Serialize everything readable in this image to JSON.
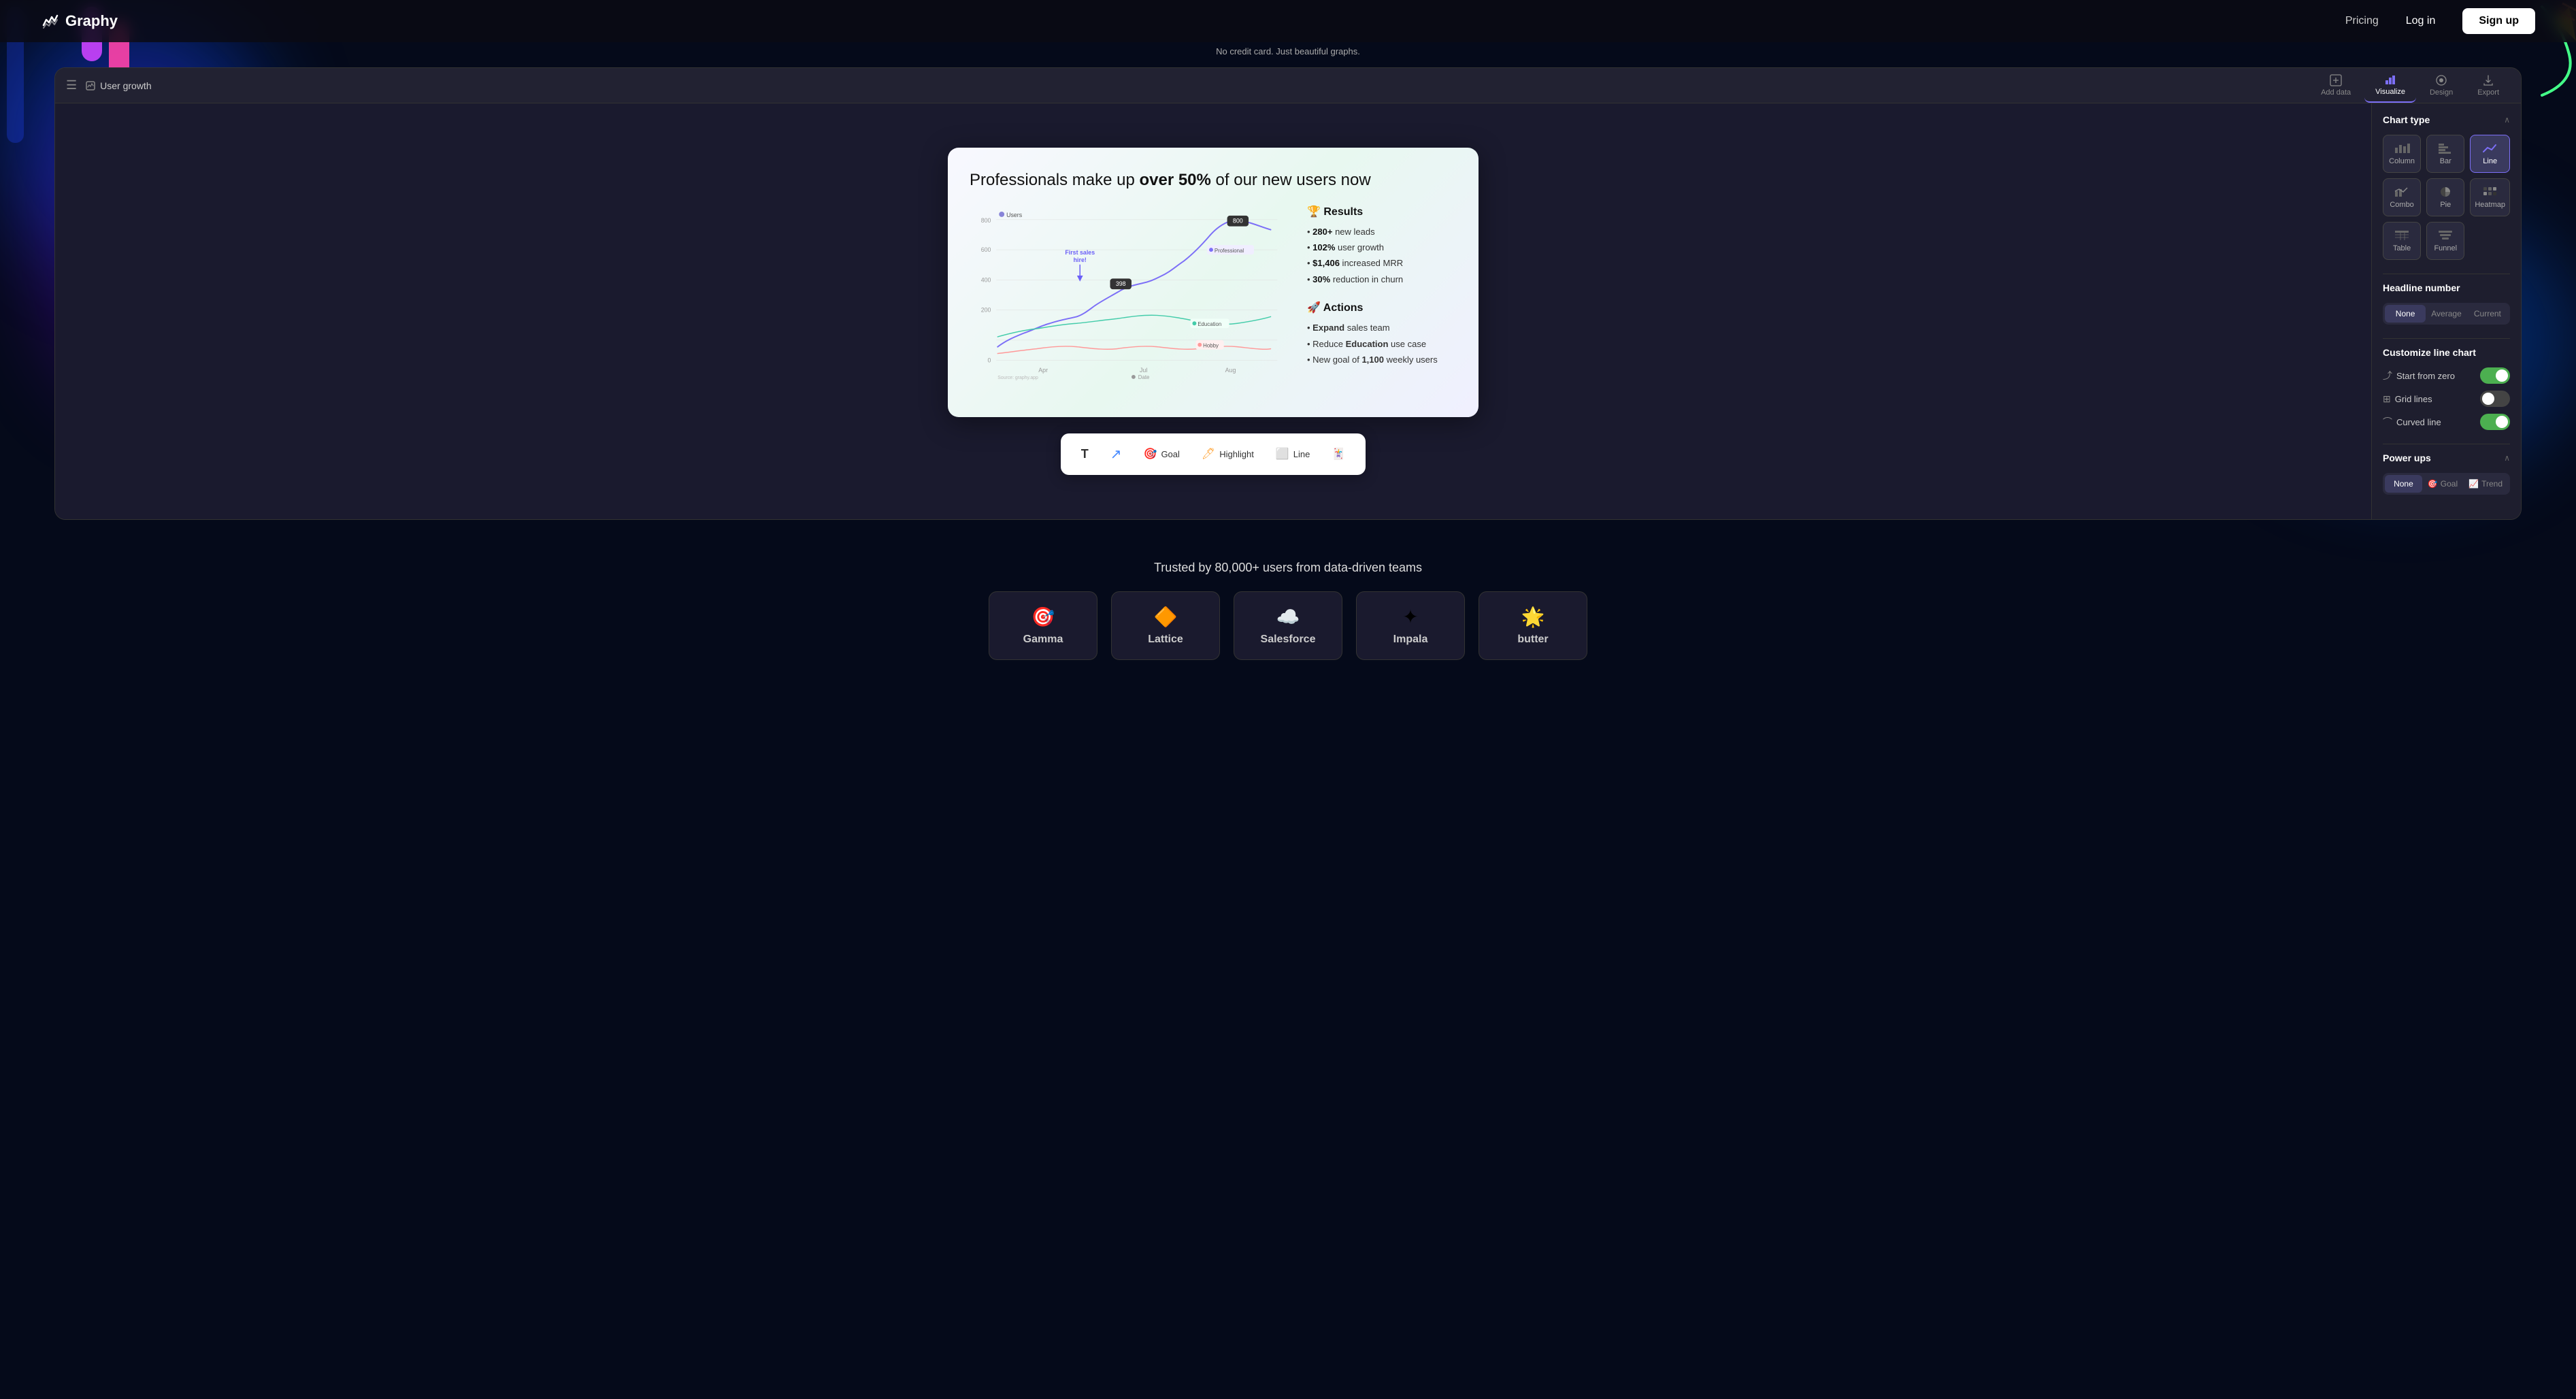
{
  "navbar": {
    "logo": "Graphy",
    "pricing": "Pricing",
    "login": "Log in",
    "signup": "Sign up"
  },
  "tagline": "No credit card. Just beautiful graphs.",
  "app": {
    "title": "User growth",
    "toolbar_buttons": [
      {
        "id": "add-data",
        "label": "Add data"
      },
      {
        "id": "visualize",
        "label": "Visualize",
        "active": true
      },
      {
        "id": "design",
        "label": "Design"
      },
      {
        "id": "export",
        "label": "Export"
      }
    ]
  },
  "chart_card": {
    "title_prefix": "Professionals make up ",
    "title_highlight": "over 50%",
    "title_suffix": " of our new users now",
    "legend": {
      "users_label": "Users"
    },
    "annotations": [
      {
        "label": "800",
        "type": "badge"
      },
      {
        "label": "Professional",
        "type": "legend-tag"
      },
      {
        "label": "398",
        "type": "badge"
      },
      {
        "label": "First sales hire!",
        "type": "annotation-text"
      },
      {
        "label": "Education",
        "type": "legend-tag"
      },
      {
        "label": "Hobby",
        "type": "legend-tag"
      }
    ],
    "y_labels": [
      "800",
      "600",
      "400",
      "200",
      "0"
    ],
    "x_labels": [
      "Apr",
      "Jul",
      "Aug"
    ],
    "source": "Source: graphy.app"
  },
  "results": {
    "title": "🏆 Results",
    "items": [
      {
        "text_bold": "280+",
        "text": " new leads"
      },
      {
        "text_bold": "102%",
        "text": " user growth"
      },
      {
        "text_bold": "$1,406",
        "text": " increased MRR"
      },
      {
        "text_bold": "30%",
        "text": " reduction in churn"
      }
    ]
  },
  "actions": {
    "title": "🚀 Actions",
    "items": [
      {
        "text_prefix": "",
        "text_bold": "Expand",
        "text_suffix": " sales team"
      },
      {
        "text_prefix": "Reduce ",
        "text_bold": "Education",
        "text_suffix": " use case"
      },
      {
        "text_prefix": "New goal of ",
        "text_bold": "1,100",
        "text_suffix": " weekly users"
      }
    ]
  },
  "bottom_toolbar": {
    "tools": [
      {
        "id": "text",
        "label": "T",
        "name": "text-tool"
      },
      {
        "id": "arrow",
        "label": "↗",
        "name": "arrow-tool"
      },
      {
        "id": "goal",
        "label": "Goal",
        "name": "goal-tool"
      },
      {
        "id": "highlight",
        "label": "Highlight",
        "name": "highlight-tool"
      },
      {
        "id": "line",
        "label": "Line",
        "name": "line-tool"
      },
      {
        "id": "emoji",
        "label": "?",
        "name": "emoji-tool"
      }
    ]
  },
  "right_panel": {
    "chart_type": {
      "title": "Chart type",
      "types": [
        {
          "id": "column",
          "label": "Column"
        },
        {
          "id": "bar",
          "label": "Bar"
        },
        {
          "id": "line",
          "label": "Line",
          "active": true
        },
        {
          "id": "combo",
          "label": "Combo"
        },
        {
          "id": "pie",
          "label": "Pie"
        },
        {
          "id": "heatmap",
          "label": "Heatmap"
        },
        {
          "id": "table",
          "label": "Table"
        },
        {
          "id": "funnel",
          "label": "Funnel"
        }
      ]
    },
    "headline_number": {
      "title": "Headline number",
      "options": [
        "None",
        "Average",
        "Current"
      ],
      "active": "None"
    },
    "customize": {
      "title": "Customize line chart",
      "options": [
        {
          "id": "start-from-zero",
          "label": "Start from zero",
          "enabled": true
        },
        {
          "id": "grid-lines",
          "label": "Grid lines",
          "enabled": false
        },
        {
          "id": "curved-line",
          "label": "Curved line",
          "enabled": true
        }
      ]
    },
    "power_ups": {
      "title": "Power ups",
      "options": [
        "None",
        "Goal",
        "Trend"
      ],
      "active": "None"
    }
  },
  "trusted": {
    "title": "Trusted by 80,000+ users from data-driven teams",
    "logos": [
      {
        "name": "Gamma",
        "icon": "🎯"
      },
      {
        "name": "Lattice",
        "icon": "🔶"
      },
      {
        "name": "Salesforce",
        "icon": "☁️"
      },
      {
        "name": "Impala",
        "icon": "✦"
      },
      {
        "name": "butter",
        "icon": "🔆"
      }
    ]
  }
}
